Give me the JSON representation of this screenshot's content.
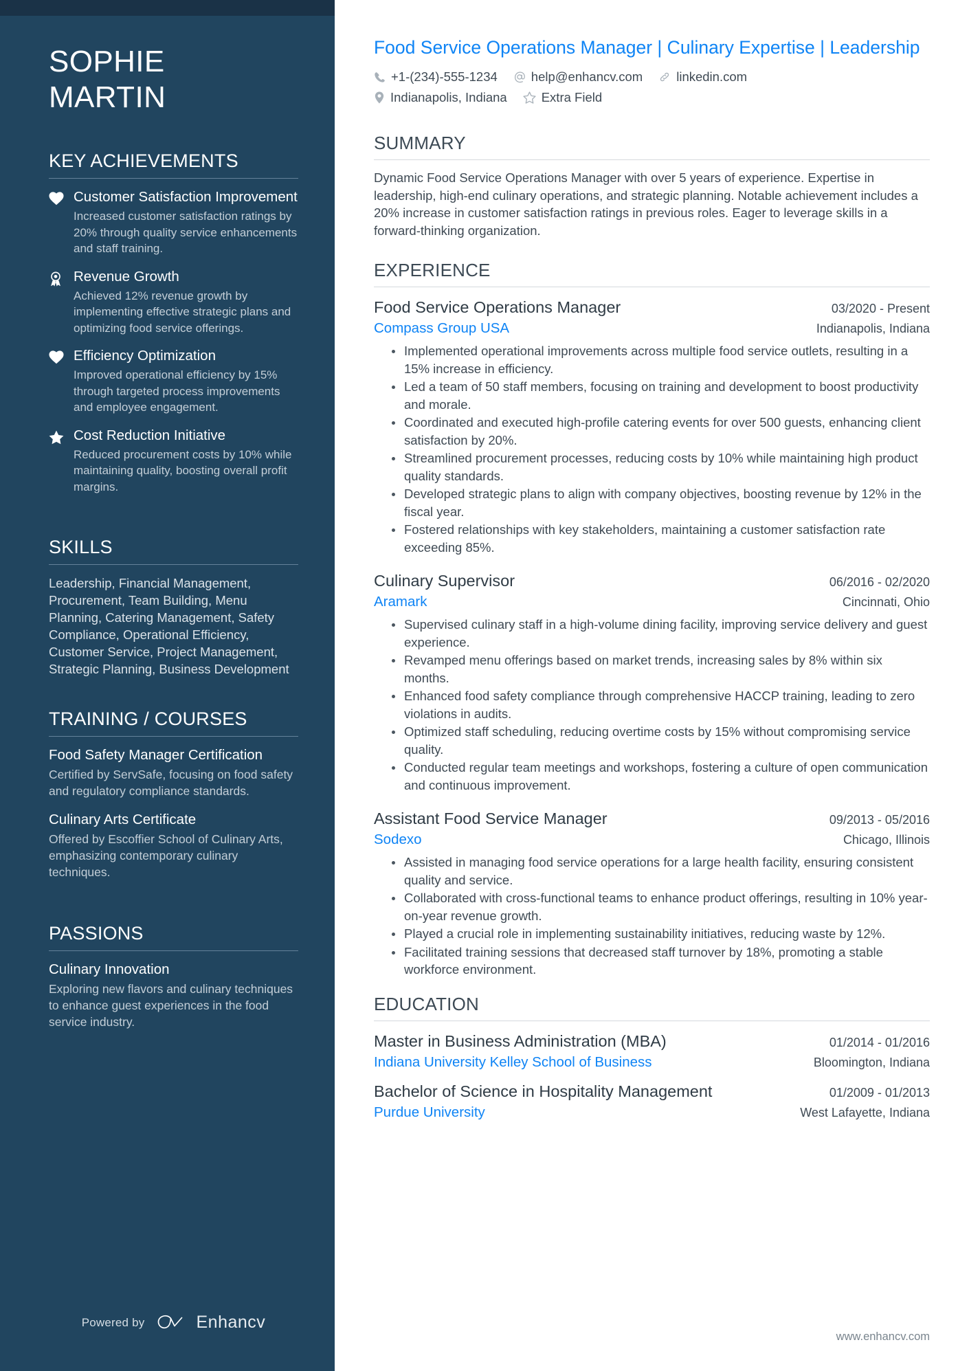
{
  "sidebar": {
    "name_lines": [
      "SOPHIE",
      "MARTIN"
    ],
    "sections": {
      "achievements": {
        "heading": "KEY ACHIEVEMENTS",
        "items": [
          {
            "icon": "heart-icon",
            "title": "Customer Satisfaction Improvement",
            "desc": "Increased customer satisfaction ratings by 20% through quality service enhancements and staff training."
          },
          {
            "icon": "award-ribbon-icon",
            "title": "Revenue Growth",
            "desc": "Achieved 12% revenue growth by implementing effective strategic plans and optimizing food service offerings."
          },
          {
            "icon": "heart-icon",
            "title": "Efficiency Optimization",
            "desc": "Improved operational efficiency by 15% through targeted process improvements and employee engagement."
          },
          {
            "icon": "star-icon",
            "title": "Cost Reduction Initiative",
            "desc": "Reduced procurement costs by 10% while maintaining quality, boosting overall profit margins."
          }
        ]
      },
      "skills": {
        "heading": "SKILLS",
        "text": "Leadership, Financial Management, Procurement, Team Building, Menu Planning, Catering Management, Safety Compliance, Operational Efficiency, Customer Service, Project Management, Strategic Planning, Business Development"
      },
      "training": {
        "heading": "TRAINING / COURSES",
        "items": [
          {
            "title": "Food Safety Manager Certification",
            "desc": "Certified by ServSafe, focusing on food safety and regulatory compliance standards."
          },
          {
            "title": "Culinary Arts Certificate",
            "desc": "Offered by Escoffier School of Culinary Arts, emphasizing contemporary culinary techniques."
          }
        ]
      },
      "passions": {
        "heading": "PASSIONS",
        "items": [
          {
            "title": "Culinary Innovation",
            "desc": "Exploring new flavors and culinary techniques to enhance guest experiences in the food service industry."
          }
        ]
      }
    },
    "footer": {
      "powered_by": "Powered by",
      "brand": "Enhancv"
    }
  },
  "main": {
    "headline": "Food Service Operations Manager | Culinary Expertise | Leadership",
    "contacts": [
      {
        "icon": "phone-icon",
        "text": "+1-(234)-555-1234"
      },
      {
        "icon": "at-sign-icon",
        "text": "help@enhancv.com"
      },
      {
        "icon": "link-icon",
        "text": "linkedin.com"
      },
      {
        "icon": "location-pin-icon",
        "text": "Indianapolis, Indiana"
      },
      {
        "icon": "star-outline-icon",
        "text": "Extra Field"
      }
    ],
    "summary": {
      "heading": "SUMMARY",
      "text": "Dynamic Food Service Operations Manager with over 5 years of experience. Expertise in leadership, high-end culinary operations, and strategic planning. Notable achievement includes a 20% increase in customer satisfaction ratings in previous roles. Eager to leverage skills in a forward-thinking organization."
    },
    "experience": {
      "heading": "EXPERIENCE",
      "entries": [
        {
          "title": "Food Service Operations Manager",
          "date": "03/2020 - Present",
          "org": "Compass Group USA",
          "location": "Indianapolis, Indiana",
          "bullets": [
            "Implemented operational improvements across multiple food service outlets, resulting in a 15% increase in efficiency.",
            "Led a team of 50 staff members, focusing on training and development to boost productivity and morale.",
            "Coordinated and executed high-profile catering events for over 500 guests, enhancing client satisfaction by 20%.",
            "Streamlined procurement processes, reducing costs by 10% while maintaining high product quality standards.",
            "Developed strategic plans to align with company objectives, boosting revenue by 12% in the fiscal year.",
            "Fostered relationships with key stakeholders, maintaining a customer satisfaction rate exceeding 85%."
          ]
        },
        {
          "title": "Culinary Supervisor",
          "date": "06/2016 - 02/2020",
          "org": "Aramark",
          "location": "Cincinnati, Ohio",
          "bullets": [
            "Supervised culinary staff in a high-volume dining facility, improving service delivery and guest experience.",
            "Revamped menu offerings based on market trends, increasing sales by 8% within six months.",
            "Enhanced food safety compliance through comprehensive HACCP training, leading to zero violations in audits.",
            "Optimized staff scheduling, reducing overtime costs by 15% without compromising service quality.",
            "Conducted regular team meetings and workshops, fostering a culture of open communication and continuous improvement."
          ]
        },
        {
          "title": "Assistant Food Service Manager",
          "date": "09/2013 - 05/2016",
          "org": "Sodexo",
          "location": "Chicago, Illinois",
          "bullets": [
            "Assisted in managing food service operations for a large health facility, ensuring consistent quality and service.",
            "Collaborated with cross-functional teams to enhance product offerings, resulting in 10% year-on-year revenue growth.",
            "Played a crucial role in implementing sustainability initiatives, reducing waste by 12%.",
            "Facilitated training sessions that decreased staff turnover by 18%, promoting a stable workforce environment."
          ]
        }
      ]
    },
    "education": {
      "heading": "EDUCATION",
      "entries": [
        {
          "title": "Master in Business Administration (MBA)",
          "date": "01/2014 - 01/2016",
          "org": "Indiana University Kelley School of Business",
          "location": "Bloomington, Indiana"
        },
        {
          "title": "Bachelor of Science in Hospitality Management",
          "date": "01/2009 - 01/2013",
          "org": "Purdue University",
          "location": "West Lafayette, Indiana"
        }
      ]
    },
    "footer_url": "www.enhancv.com"
  },
  "colors": {
    "sidebar_bg": "#21455f",
    "sidebar_topbar": "#1a3247",
    "accent_blue": "#0f84f5",
    "body_text": "#3f4a54"
  }
}
